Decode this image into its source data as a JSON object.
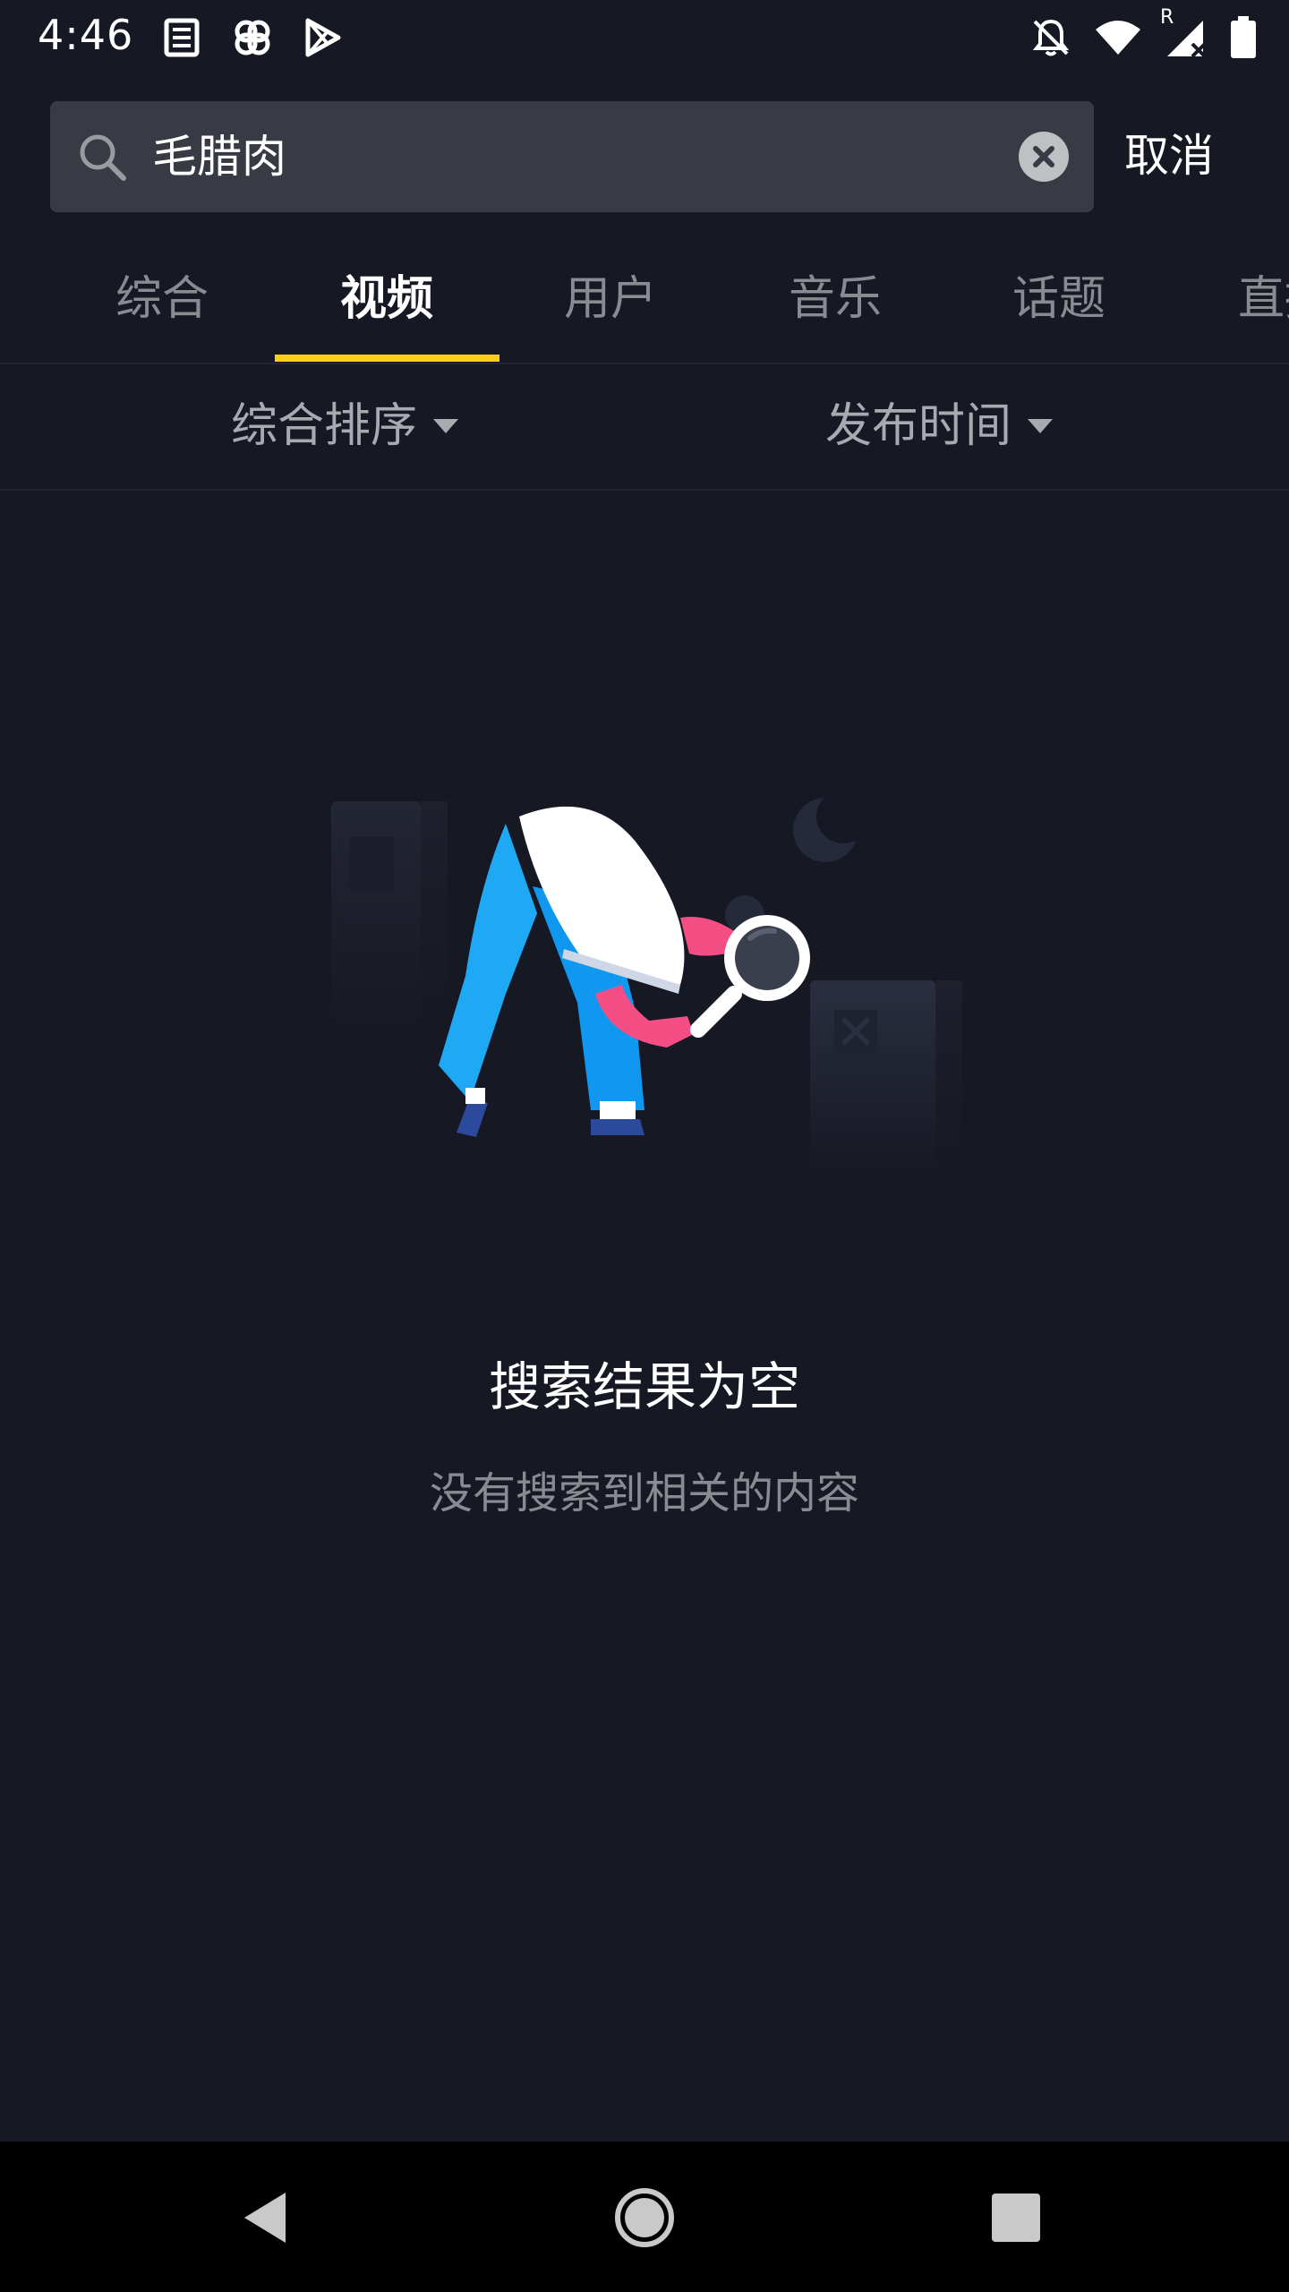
{
  "status_bar": {
    "time": "4:46",
    "left_icons": [
      "news-icon",
      "pinwheel-icon",
      "play-store-icon"
    ],
    "right_icons": [
      "notifications-off-icon",
      "wifi-icon",
      "signal-roaming-icon",
      "battery-icon"
    ],
    "roaming_label": "R"
  },
  "search": {
    "value": "毛腊肉",
    "placeholder": "搜索",
    "cancel_label": "取消"
  },
  "tabs": [
    {
      "label": "综合",
      "active": false
    },
    {
      "label": "视频",
      "active": true
    },
    {
      "label": "用户",
      "active": false
    },
    {
      "label": "音乐",
      "active": false
    },
    {
      "label": "话题",
      "active": false
    },
    {
      "label": "直播",
      "active": false
    }
  ],
  "filters": {
    "sort_label": "综合排序",
    "time_label": "发布时间"
  },
  "empty_state": {
    "title": "搜索结果为空",
    "subtitle": "没有搜索到相关的内容"
  },
  "colors": {
    "background": "#161823",
    "search_box": "#393b44",
    "accent": "#facf19",
    "muted_text": "#8a8b91"
  },
  "nav_bar": {
    "icons": [
      "back-icon",
      "home-icon",
      "recents-icon"
    ]
  }
}
